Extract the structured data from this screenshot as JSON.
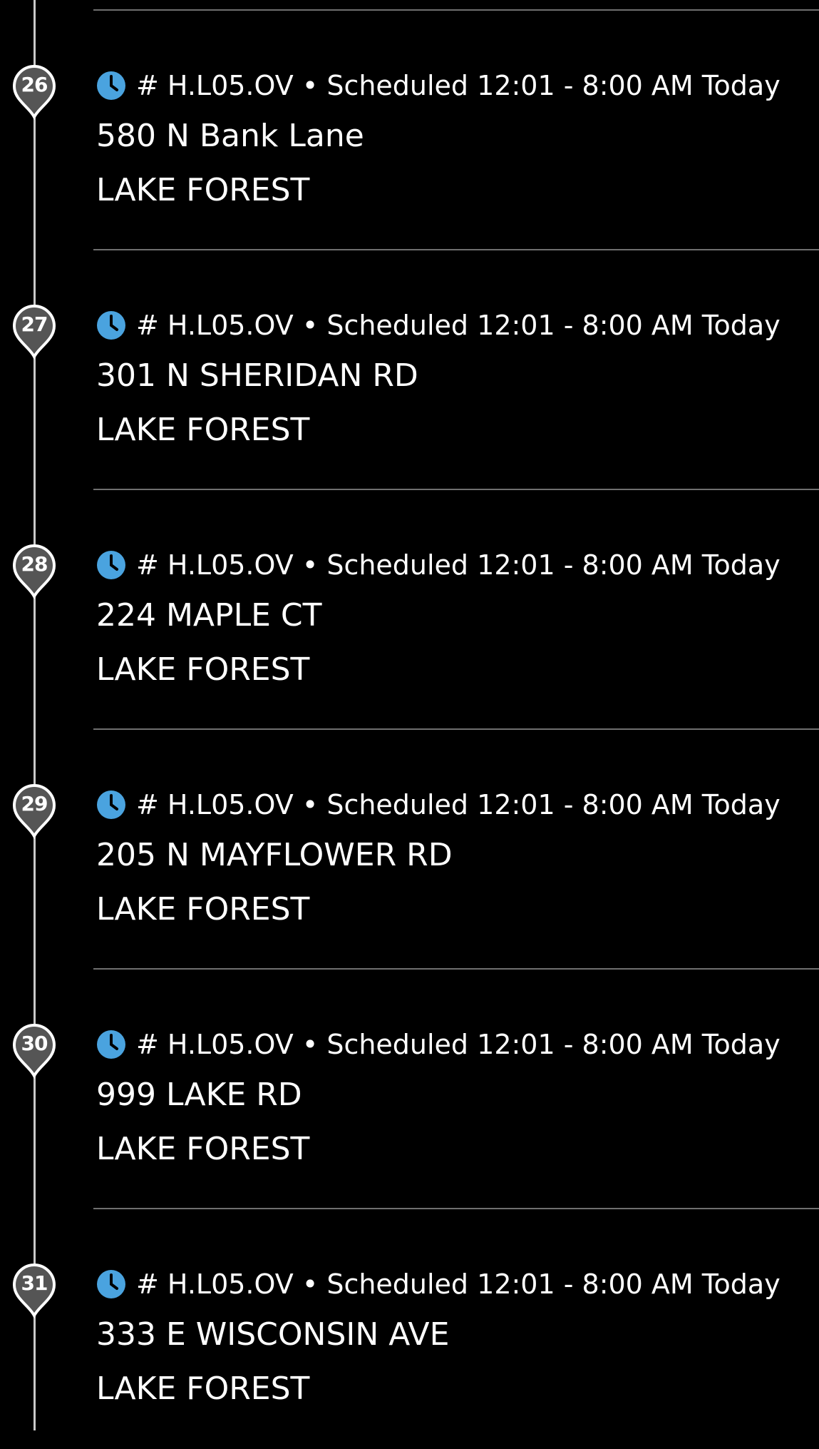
{
  "theme": {
    "background": "#000000",
    "text": "#ffffff",
    "accent_clock": "#4aa3df",
    "pin_fill": "#555555",
    "pin_stroke": "#ffffff",
    "timeline": "#c9c9c9",
    "divider": "#6f6f6f"
  },
  "icons": {
    "status": "clock-icon",
    "marker": "map-pin-icon"
  },
  "stops": [
    {
      "number": "26",
      "meta": "# H.L05.OV • Scheduled 12:01 - 8:00 AM Today",
      "address": "580 N Bank Lane",
      "city": "LAKE FOREST"
    },
    {
      "number": "27",
      "meta": "# H.L05.OV • Scheduled 12:01 - 8:00 AM Today",
      "address": "301 N SHERIDAN RD",
      "city": "LAKE FOREST"
    },
    {
      "number": "28",
      "meta": "# H.L05.OV • Scheduled 12:01 - 8:00 AM Today",
      "address": "224 MAPLE CT",
      "city": "LAKE FOREST"
    },
    {
      "number": "29",
      "meta": "# H.L05.OV • Scheduled 12:01 - 8:00 AM Today",
      "address": "205 N MAYFLOWER RD",
      "city": "LAKE FOREST"
    },
    {
      "number": "30",
      "meta": "# H.L05.OV • Scheduled 12:01 - 8:00 AM Today",
      "address": "999 LAKE RD",
      "city": "LAKE FOREST"
    },
    {
      "number": "31",
      "meta": "# H.L05.OV • Scheduled 12:01 - 8:00 AM Today",
      "address": "333 E WISCONSIN AVE",
      "city": "LAKE FOREST"
    }
  ]
}
